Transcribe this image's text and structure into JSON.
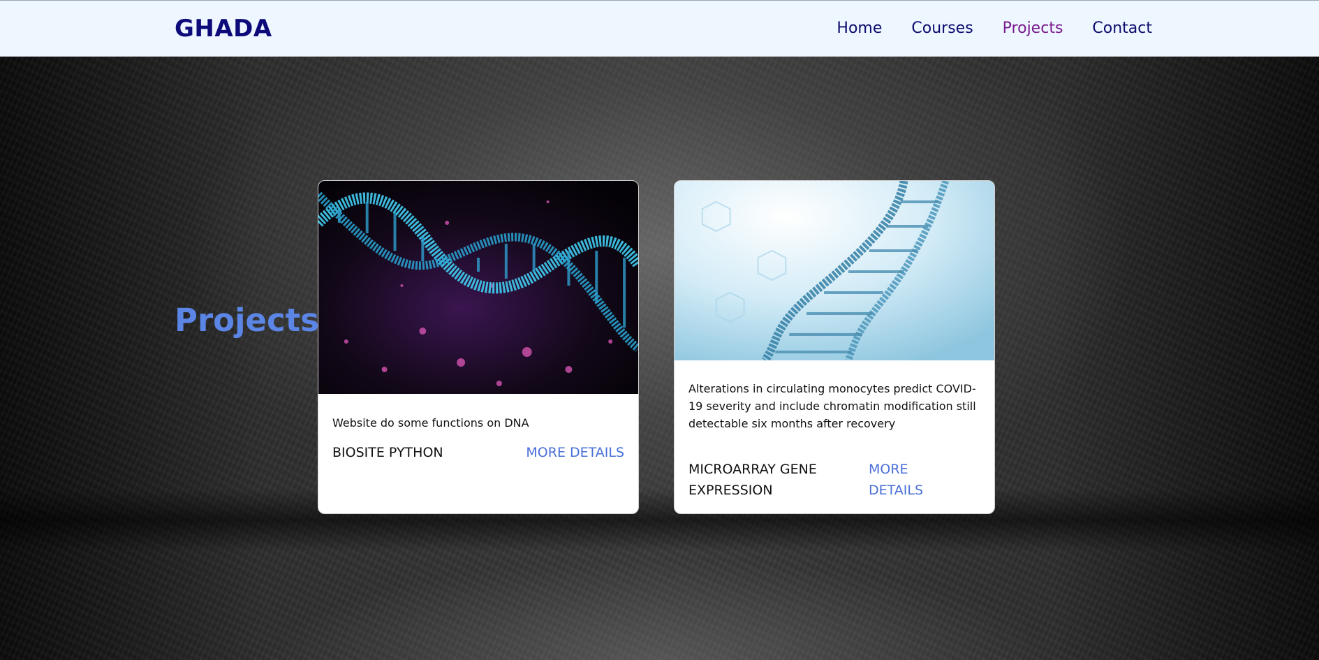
{
  "header": {
    "logo": "GHADA",
    "nav": [
      {
        "label": "Home",
        "active": false
      },
      {
        "label": "Courses",
        "active": false
      },
      {
        "label": "Projects",
        "active": true
      },
      {
        "label": "Contact",
        "active": false
      }
    ]
  },
  "main": {
    "section_title": "Projects",
    "cards": [
      {
        "image": "dna-helix-dark-purple-image",
        "description": "Website do some functions on DNA",
        "name": "BIOSITE PYTHON",
        "link": "MORE DETAILS"
      },
      {
        "image": "dna-helix-light-blue-image",
        "description": "Alterations in circulating monocytes predict COVID-19 severity and include chromatin modification still detectable six months after recovery",
        "name": "MICROARRAY GENE EXPRESSION",
        "link": "MORE DETAILS"
      }
    ]
  },
  "colors": {
    "logo": "#0d0b7a",
    "nav": "#0d0b6e",
    "nav_active": "#7a1a8c",
    "section_title": "#5b86e6",
    "link": "#4a6fd9",
    "header_bg": "#eef7ff"
  }
}
